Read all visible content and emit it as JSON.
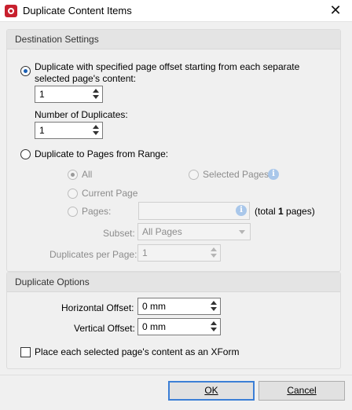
{
  "window": {
    "title": "Duplicate Content Items",
    "close_glyph": "✕"
  },
  "destination": {
    "header": "Destination Settings",
    "offset_option": {
      "label_line1": "Duplicate with specified page offset starting from each separate",
      "label_line2": "selected page's content:",
      "offset_value": "1",
      "num_duplicates_label": "Number of Duplicates:",
      "num_duplicates_value": "1"
    },
    "range_option": {
      "label": "Duplicate to Pages from Range:",
      "all_label": "All",
      "current_label": "Current Page",
      "pages_label": "Pages:",
      "selected_label": "Selected Pages",
      "total_prefix": "(total ",
      "total_value": "1",
      "total_suffix": " pages)",
      "subset_label": "Subset:",
      "subset_value": "All Pages",
      "dup_per_page_label": "Duplicates per Page:",
      "dup_per_page_value": "1"
    }
  },
  "duplicate_options": {
    "header": "Duplicate Options",
    "h_offset_label": "Horizontal Offset:",
    "h_offset_value": "0 mm",
    "v_offset_label": "Vertical Offset:",
    "v_offset_value": "0 mm",
    "xform_label": "Place each selected page's content as an XForm"
  },
  "buttons": {
    "ok": "OK",
    "cancel": "Cancel"
  },
  "icons": {
    "info": "i"
  }
}
